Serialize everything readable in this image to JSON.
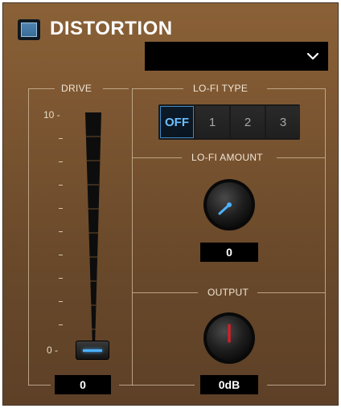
{
  "plugin": {
    "title": "DISTORTION",
    "enabled": true,
    "preset_value": ""
  },
  "drive": {
    "label": "DRIVE",
    "max_label": "10 -",
    "min_label": "0 -",
    "value": "0",
    "level": 0
  },
  "lofi_type": {
    "label": "LO-FI TYPE",
    "options": [
      "OFF",
      "1",
      "2",
      "3"
    ],
    "selected": "OFF"
  },
  "lofi_amount": {
    "label": "LO-FI AMOUNT",
    "value": "0"
  },
  "output": {
    "label": "OUTPUT",
    "value": "0dB"
  },
  "colors": {
    "accent": "#4db2ff",
    "output_indicator": "#d0202a"
  }
}
